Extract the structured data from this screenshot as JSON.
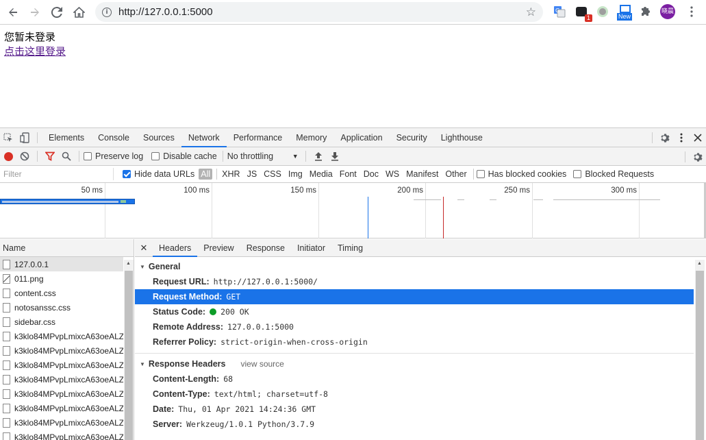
{
  "browser": {
    "url": "http://127.0.0.1:5000",
    "extension_badge": "1",
    "extension_new_label": "New",
    "profile_name": "晓晨"
  },
  "page": {
    "status_text": "您暂未登录",
    "login_link": "点击这里登录"
  },
  "devtools": {
    "tabs": [
      "Elements",
      "Console",
      "Sources",
      "Network",
      "Performance",
      "Memory",
      "Application",
      "Security",
      "Lighthouse"
    ],
    "active_tab": "Network",
    "network_toolbar": {
      "preserve_log": "Preserve log",
      "disable_cache": "Disable cache",
      "throttling": "No throttling"
    },
    "filter_bar": {
      "placeholder": "Filter",
      "hide_data_urls": "Hide data URLs",
      "types": [
        "All",
        "XHR",
        "JS",
        "CSS",
        "Img",
        "Media",
        "Font",
        "Doc",
        "WS",
        "Manifest",
        "Other"
      ],
      "has_blocked_cookies": "Has blocked cookies",
      "blocked_requests": "Blocked Requests"
    },
    "timeline_ticks": [
      "50 ms",
      "100 ms",
      "150 ms",
      "200 ms",
      "250 ms",
      "300 ms"
    ],
    "name_header": "Name",
    "requests": [
      "127.0.0.1",
      "011.png",
      "content.css",
      "notosanssc.css",
      "sidebar.css",
      "k3klo84MPvpLmixcA63oeALZ",
      "k3klo84MPvpLmixcA63oeALZ",
      "k3klo84MPvpLmixcA63oeALZ",
      "k3klo84MPvpLmixcA63oeALZ",
      "k3klo84MPvpLmixcA63oeALZ",
      "k3klo84MPvpLmixcA63oeALZ",
      "k3klo84MPvpLmixcA63oeALZ",
      "k3klo84MPvpLmixcA63oeALZ"
    ],
    "detail_tabs": [
      "Headers",
      "Preview",
      "Response",
      "Initiator",
      "Timing"
    ],
    "active_detail_tab": "Headers",
    "general": {
      "title": "General",
      "rows": [
        {
          "key": "Request URL:",
          "value": "http://127.0.0.1:5000/"
        },
        {
          "key": "Request Method:",
          "value": "GET"
        },
        {
          "key": "Status Code:",
          "value": "200 OK"
        },
        {
          "key": "Remote Address:",
          "value": "127.0.0.1:5000"
        },
        {
          "key": "Referrer Policy:",
          "value": "strict-origin-when-cross-origin"
        }
      ]
    },
    "response_headers": {
      "title": "Response Headers",
      "view_source": "view source",
      "rows": [
        {
          "key": "Content-Length:",
          "value": "68"
        },
        {
          "key": "Content-Type:",
          "value": "text/html; charset=utf-8"
        },
        {
          "key": "Date:",
          "value": "Thu, 01 Apr 2021 14:24:36 GMT"
        },
        {
          "key": "Server:",
          "value": "Werkzeug/1.0.1 Python/3.7.9"
        }
      ]
    }
  },
  "colors": {
    "accent": "#1a73e8",
    "record": "#d93025",
    "status_ok": "#0d9d28"
  }
}
